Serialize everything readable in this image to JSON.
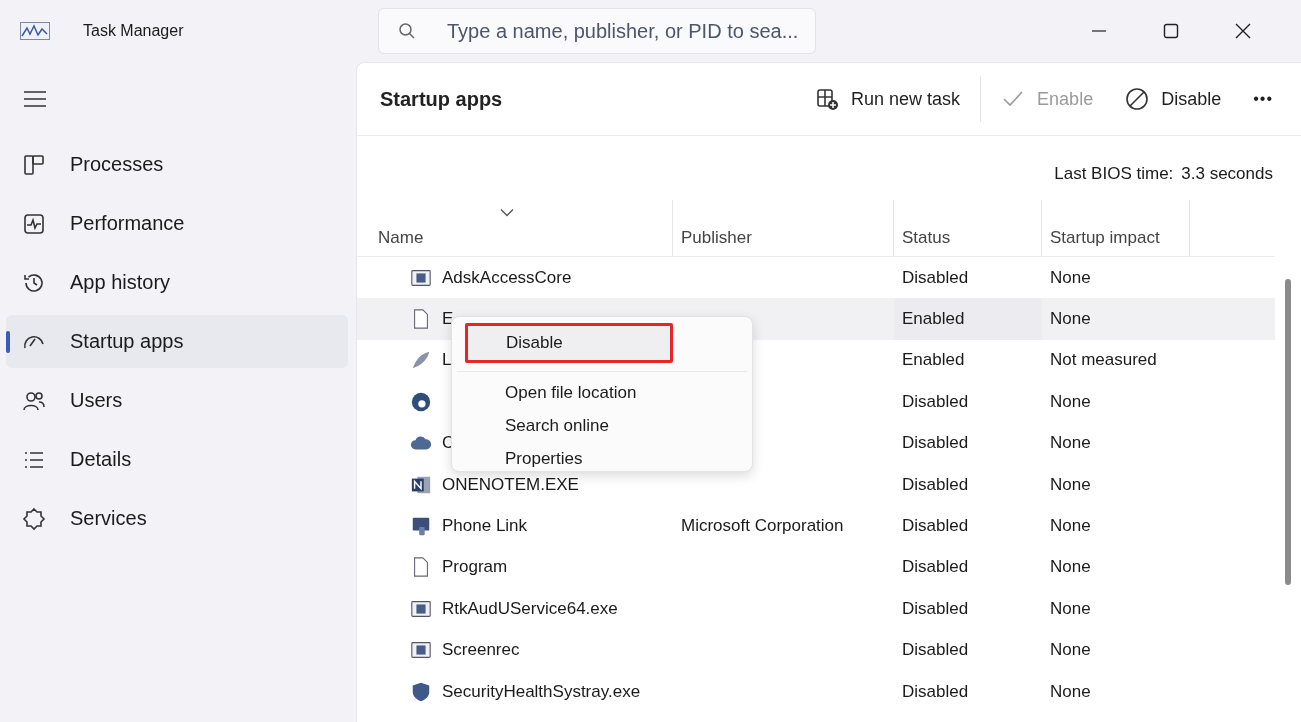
{
  "window": {
    "title": "Task Manager"
  },
  "search": {
    "placeholder": "Type a name, publisher, or PID to sea..."
  },
  "sidebar": {
    "items": [
      {
        "label": "Processes",
        "selected": false
      },
      {
        "label": "Performance",
        "selected": false
      },
      {
        "label": "App history",
        "selected": false
      },
      {
        "label": "Startup apps",
        "selected": true
      },
      {
        "label": "Users",
        "selected": false
      },
      {
        "label": "Details",
        "selected": false
      },
      {
        "label": "Services",
        "selected": false
      }
    ]
  },
  "page": {
    "title": "Startup apps"
  },
  "toolbar": [
    {
      "label": "Run new task",
      "disabled": false
    },
    {
      "label": "Enable",
      "disabled": true
    },
    {
      "label": "Disable",
      "disabled": false
    },
    {
      "label": "•••",
      "disabled": false
    }
  ],
  "bios_time": {
    "label": "Last BIOS time:",
    "value": "3.3 seconds"
  },
  "table": {
    "columns": [
      "Name",
      "Publisher",
      "Status",
      "Startup impact"
    ],
    "rows": [
      {
        "kind": "app",
        "name": "AdskAccessCore",
        "status": "Disabled",
        "impact": "None",
        "selected": false
      },
      {
        "kind": "file",
        "name": "E",
        "status": "Enabled",
        "impact": "None",
        "selected": true
      },
      {
        "kind": "feather",
        "name": "L",
        "status": "Enabled",
        "impact": "Not measured",
        "selected": false
      },
      {
        "kind": "edge",
        "status": "Disabled",
        "impact": "None",
        "selected": false
      },
      {
        "kind": "cloud",
        "name": "C",
        "status": "Disabled",
        "impact": "None",
        "selected": false
      },
      {
        "kind": "note",
        "name": "ONENOTEM.EXE",
        "status": "Disabled",
        "impact": "None",
        "selected": false
      },
      {
        "kind": "phone",
        "name": "Phone Link",
        "publisher": "Microsoft Corporation",
        "status": "Disabled",
        "impact": "None",
        "selected": false
      },
      {
        "kind": "file",
        "name": "Program",
        "status": "Disabled",
        "impact": "None",
        "selected": false
      },
      {
        "kind": "app",
        "name": "RtkAudUService64.exe",
        "status": "Disabled",
        "impact": "None",
        "selected": false
      },
      {
        "kind": "app",
        "name": "Screenrec",
        "status": "Disabled",
        "impact": "None",
        "selected": false
      },
      {
        "kind": "shield",
        "name": "SecurityHealthSystray.exe",
        "status": "Disabled",
        "impact": "None",
        "selected": false
      }
    ]
  },
  "context_menu": {
    "items": [
      {
        "label": "Disable",
        "highlighted": true
      },
      {
        "label": "Open file location",
        "highlighted": false
      },
      {
        "label": "Search online",
        "highlighted": false
      },
      {
        "label": "Properties",
        "highlighted": false
      }
    ]
  }
}
